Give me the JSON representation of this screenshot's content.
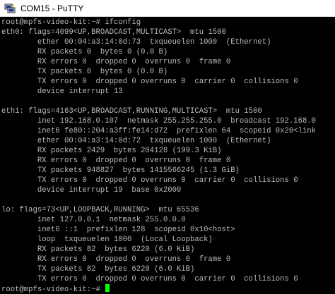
{
  "window": {
    "title": "COM15 - PuTTY",
    "icon": "putty-icon"
  },
  "colors": {
    "terminal_background": "#000000",
    "terminal_text": "#bbbbbb",
    "cursor": "#00ff00",
    "titlebar_background": "#ffffff"
  },
  "terminal": {
    "lines": [
      "root@mpfs-video-kit:~# ifconfig",
      "eth0: flags=4099<UP,BROADCAST,MULTICAST>  mtu 1500",
      "        ether 00:04:a3:14:0d:73  txqueuelen 1000  (Ethernet)",
      "        RX packets 0  bytes 0 (0.0 B)",
      "        RX errors 0  dropped 0  overruns 0  frame 0",
      "        TX packets 0  bytes 0 (0.0 B)",
      "        TX errors 0  dropped 0 overruns 0  carrier 0  collisions 0",
      "        device interrupt 13",
      "",
      "eth1: flags=4163<UP,BROADCAST,RUNNING,MULTICAST>  mtu 1500",
      "        inet 192.168.0.107  netmask 255.255.255.0  broadcast 192.168.0",
      "        inet6 fe80::204:a3ff:fe14:d72  prefixlen 64  scopeid 0x20<link",
      "        ether 00:04:a3:14:0d:72  txqueuelen 1000  (Ethernet)",
      "        RX packets 2429  bytes 204128 (199.3 KiB)",
      "        RX errors 0  dropped 0  overruns 0  frame 0",
      "        TX packets 948827  bytes 1415566245 (1.3 GiB)",
      "        TX errors 0  dropped 0 overruns 0  carrier 0  collisions 0",
      "        device interrupt 19  base 0x2000",
      "",
      "lo: flags=73<UP,LOOPBACK,RUNNING>  mtu 65536",
      "        inet 127.0.0.1  netmask 255.0.0.0",
      "        inet6 ::1  prefixlen 128  scopeid 0x10<host>",
      "        loop  txqueuelen 1000  (Local Loopback)",
      "        RX packets 82  bytes 6220 (6.0 KiB)",
      "        RX errors 0  dropped 0  overruns 0  frame 0",
      "        TX packets 82  bytes 6220 (6.0 KiB)",
      "        TX errors 0  dropped 0 overruns 0  carrier 0  collisions 0",
      ""
    ],
    "prompt": "root@mpfs-video-kit:~# "
  }
}
